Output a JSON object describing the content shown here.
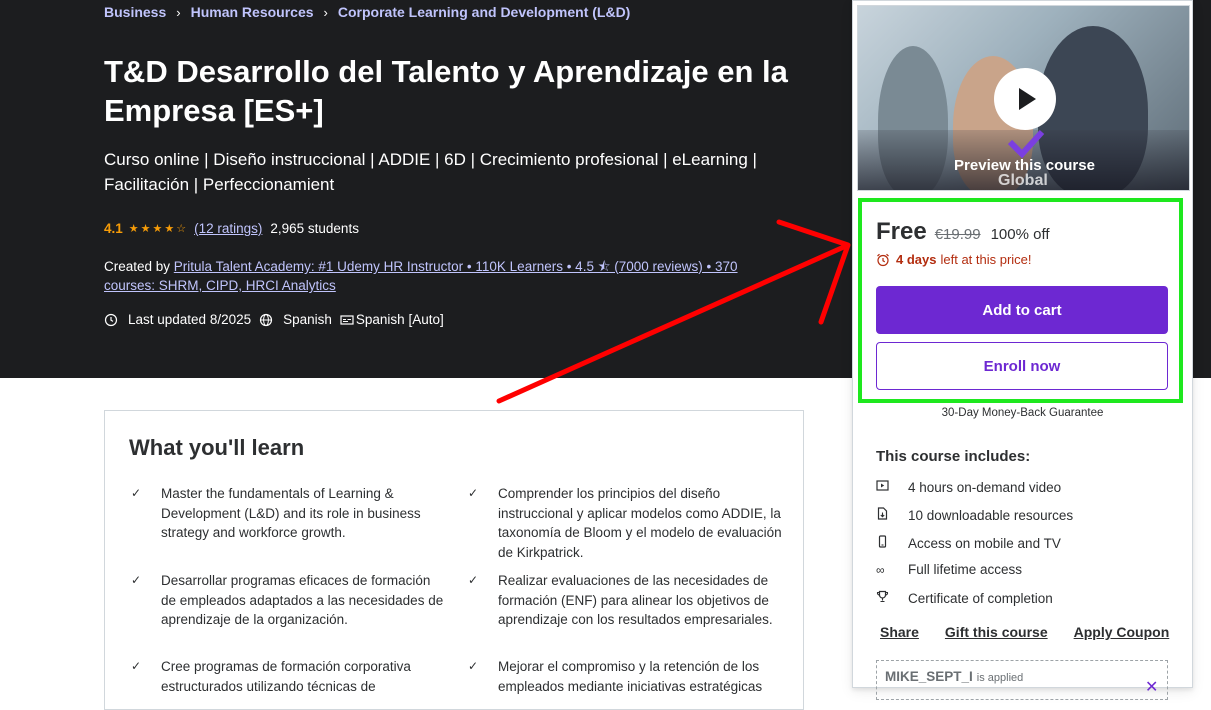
{
  "breadcrumb": [
    "Business",
    "Human Resources",
    "Corporate Learning and Development (L&D)"
  ],
  "course": {
    "title": "T&D Desarrollo del Talento y Aprendizaje en la Empresa [ES+]",
    "subtitle": "Curso online | Diseño instruccional | ADDIE | 6D | Crecimiento profesional | eLearning | Facilitación | Perfeccionamient",
    "rating": "4.1",
    "stars": "★★★★☆",
    "ratings_link": "(12 ratings)",
    "students": "2,965 students",
    "created_by_label": "Created by",
    "instructor": "Pritula Talent Academy: #1 Udemy HR Instructor • 110K Learners • 4.5 ⯪ (7000 reviews) • 370 courses: SHRM, CIPD, HRCI Analytics",
    "last_updated": "Last updated 8/2025",
    "language": "Spanish",
    "captions": "Spanish [Auto]"
  },
  "learn": {
    "title": "What you'll learn",
    "items": [
      "Master the fundamentals of Learning & Development (L&D) and its role in business strategy and workforce growth.",
      "Comprender los principios del diseño instruccional y aplicar modelos como ADDIE, la taxonomía de Bloom y el modelo de evaluación de Kirkpatrick.",
      "Desarrollar programas eficaces de formación de empleados adaptados a las necesidades de aprendizaje de la organización.",
      "Realizar evaluaciones de las necesidades de formación (ENF) para alinear los objetivos de aprendizaje con los resultados empresariales.",
      "Cree programas de formación corporativa estructurados utilizando técnicas de",
      "Mejorar el compromiso y la retención de los empleados mediante iniciativas estratégicas"
    ]
  },
  "sidebar": {
    "preview_label": "Preview this course",
    "preview_logo_text": "Global",
    "price": "Free",
    "original_price": "€19.99",
    "discount": "100% off",
    "timer_days": "4 days",
    "timer_rest": "left at this price!",
    "add_to_cart": "Add to cart",
    "enroll_now": "Enroll now",
    "guarantee": "30-Day Money-Back Guarantee",
    "includes_title": "This course includes:",
    "includes": [
      {
        "icon": "video-icon",
        "text": "4 hours on-demand video"
      },
      {
        "icon": "file-download-icon",
        "text": "10 downloadable resources"
      },
      {
        "icon": "mobile-icon",
        "text": "Access on mobile and TV"
      },
      {
        "icon": "infinity-icon",
        "text": "Full lifetime access"
      },
      {
        "icon": "trophy-icon",
        "text": "Certificate of completion"
      }
    ],
    "share": "Share",
    "gift": "Gift this course",
    "apply_coupon": "Apply Coupon",
    "coupon_code": "MIKE_SEPT_I",
    "coupon_applied": "is applied"
  },
  "colors": {
    "hero_bg": "#1c1d1f",
    "link_purple": "#c0c4fc",
    "star": "#f69c08",
    "primary": "#6d28d2",
    "timer_red": "#b32d0f",
    "highlight_green": "#1ee81e",
    "annotation_red": "#ff0000"
  }
}
